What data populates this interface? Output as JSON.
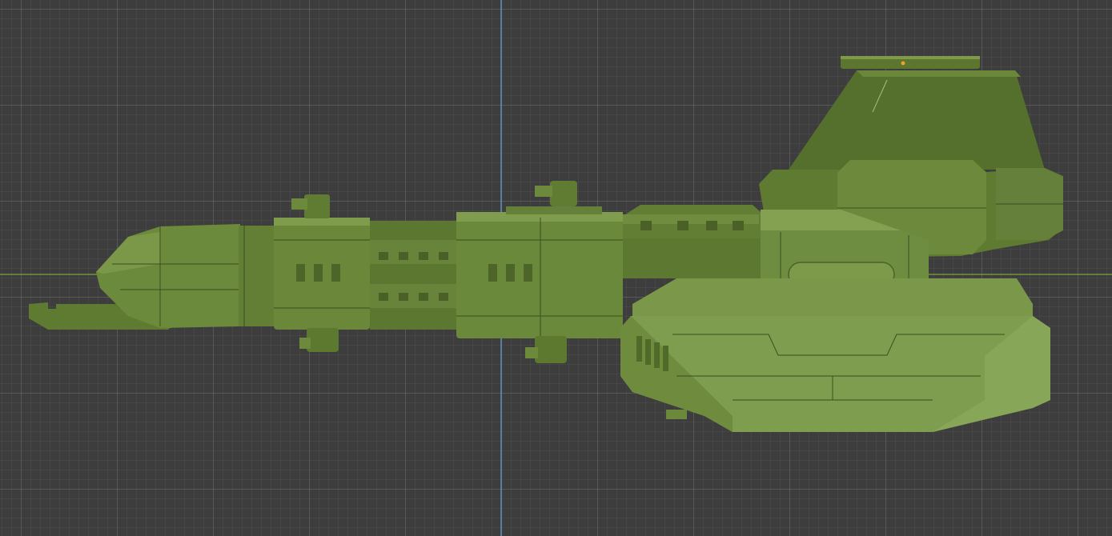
{
  "viewport": {
    "mode": "orthographic-side-view",
    "background": "#3d3d3d",
    "grid_major": "#5a5a5a",
    "grid_minor": "#474747",
    "axis_x_color": "#7fa33a",
    "axis_z_color": "#5f8fc0"
  },
  "model": {
    "object": "spaceship-hull",
    "base_color": "#6f8a3e",
    "shadow_color": "#4c6029",
    "highlight_color": "#98b160",
    "origin_marker_color": "#f0a020"
  }
}
